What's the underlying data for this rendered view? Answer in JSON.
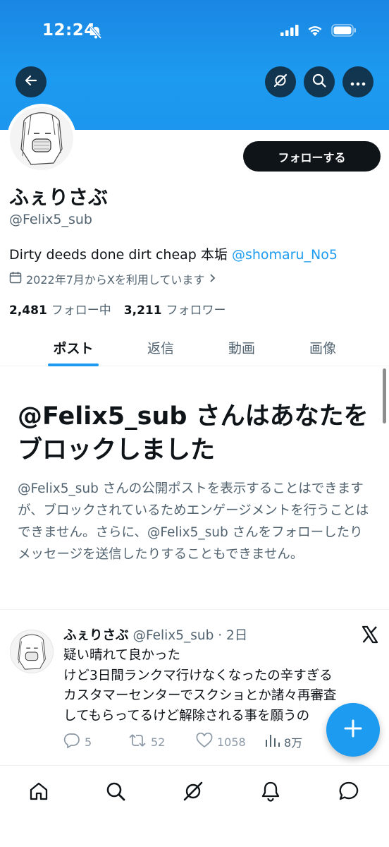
{
  "status_bar": {
    "time": "12:24"
  },
  "profile": {
    "display_name": "ふぇりさぶ",
    "handle": "@Felix5_sub",
    "bio_text": "Dirty deeds done dirt cheap 本垢 ",
    "bio_link": "@shomaru_No5",
    "joined": "2022年7月からXを利用しています",
    "following_count": "2,481",
    "following_label": "フォロー中",
    "followers_count": "3,211",
    "followers_label": "フォロワー",
    "follow_button": "フォローする"
  },
  "tabs": [
    {
      "label": "ポスト",
      "active": true
    },
    {
      "label": "返信",
      "active": false
    },
    {
      "label": "動画",
      "active": false
    },
    {
      "label": "画像",
      "active": false
    }
  ],
  "blocked": {
    "title": "@Felix5_sub さんはあなたをブロックしました",
    "description": "@Felix5_sub さんの公開ポストを表示することはできますが、ブロックされているためエンゲージメントを行うことはできません。さらに、@Felix5_sub さんをフォローしたりメッセージを送信したりすることもできません。"
  },
  "tweet": {
    "name": "ふぇりさぶ",
    "meta": "@Felix5_sub · 2日",
    "text": "疑い晴れて良かった\nけど3日間ランクマ行けなくなったの辛すぎる\nカスタマーセンターでスクショとか諸々再審査\nしてもらってるけど解除される事を願うの",
    "replies": "5",
    "reposts": "52",
    "likes": "1058",
    "views": "8万"
  },
  "icons": {
    "back": "arrow-left-icon",
    "grok": "grok-icon",
    "search": "search-icon",
    "more": "more-icon",
    "calendar": "calendar-icon",
    "compose": "plus-icon",
    "nav": [
      "home-icon",
      "search-icon",
      "grok-icon",
      "bell-icon",
      "message-icon"
    ]
  },
  "colors": {
    "accent": "#1d9bf0",
    "text": "#0f1419",
    "muted": "#536471"
  }
}
